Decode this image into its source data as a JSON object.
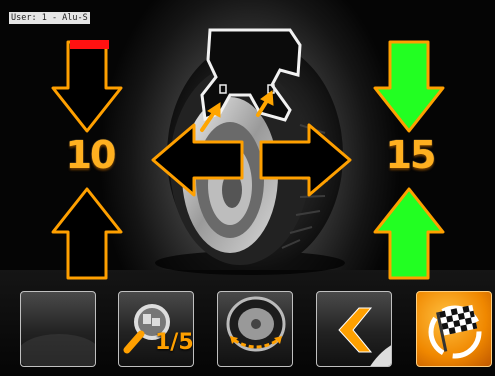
{
  "user": {
    "label": "User: 1 - Alu-S"
  },
  "values": {
    "left": "10",
    "right": "15"
  },
  "colors": {
    "accent_orange": "#ffa000",
    "active_green": "#22ff22",
    "marker_red": "#ff1111",
    "background": "#111111"
  },
  "icons": {
    "arrow_left_down": "arrow-down-outline",
    "arrow_left_up": "arrow-up-outline",
    "arrow_right_down": "arrow-down-green",
    "arrow_right_up": "arrow-up-green",
    "arrow_center_left": "arrow-left-outline",
    "arrow_center_right": "arrow-right-outline",
    "wheel": "tire-rim-cutaway"
  },
  "toolbar": {
    "buttons": [
      {
        "icon": "blank-button"
      },
      {
        "icon": "zoom-step-icon",
        "label": "1/5"
      },
      {
        "icon": "wheel-rotate-icon"
      },
      {
        "icon": "back-arrow-icon"
      },
      {
        "icon": "finish-flag-icon"
      }
    ]
  }
}
